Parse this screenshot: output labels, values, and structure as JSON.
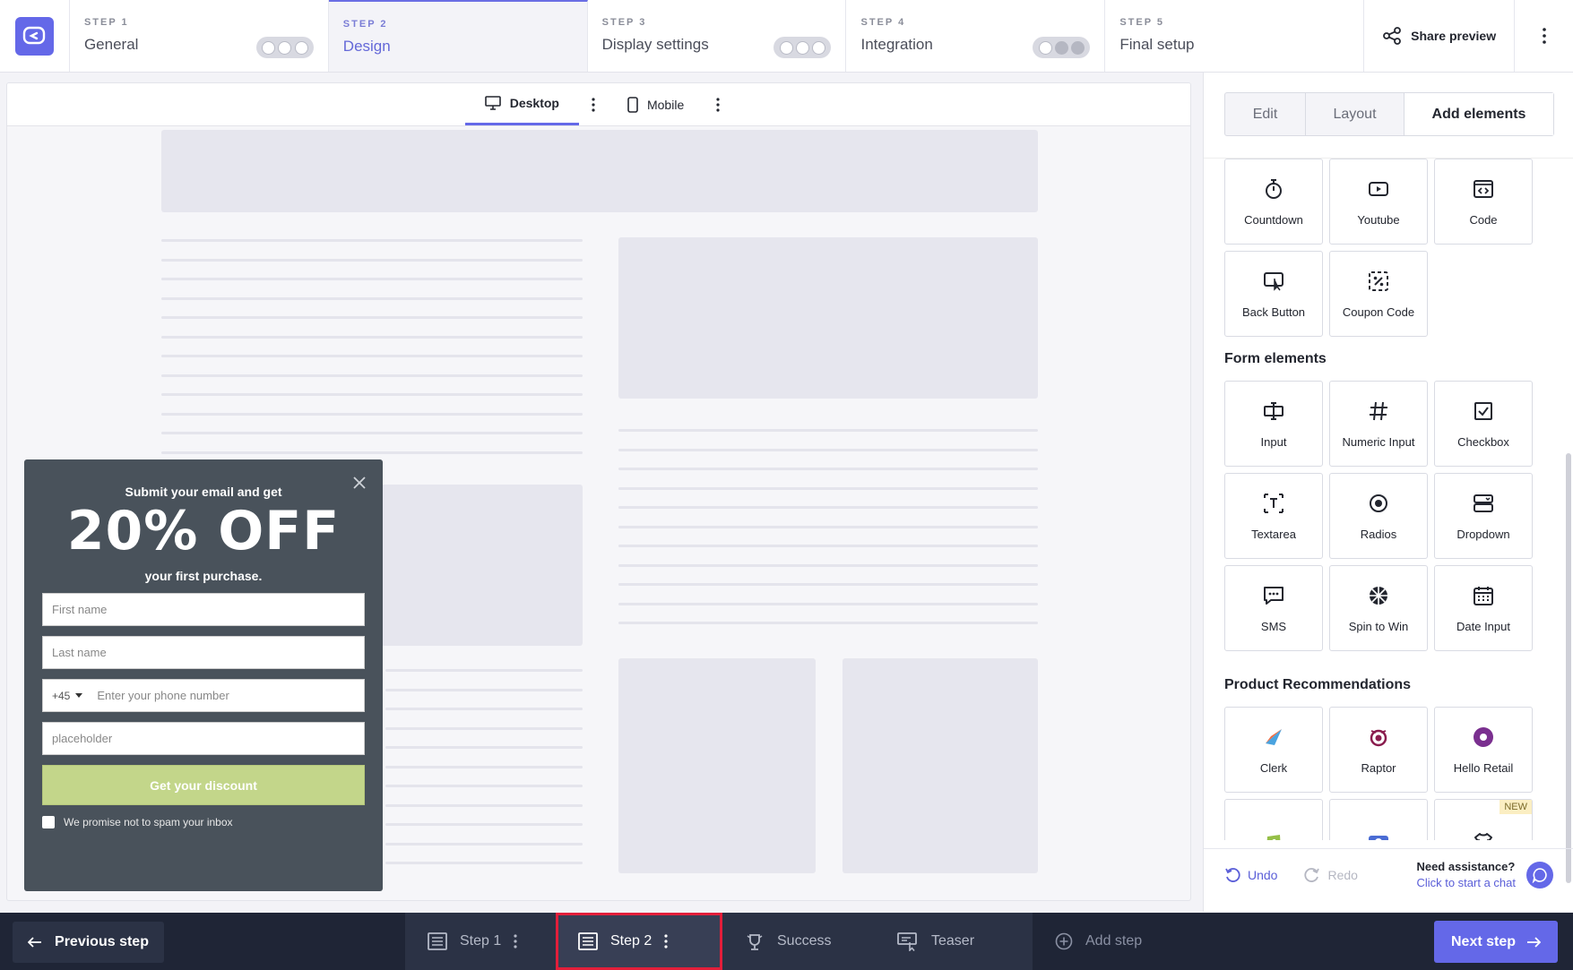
{
  "steps": [
    {
      "num": "STEP 1",
      "name": "General"
    },
    {
      "num": "STEP 2",
      "name": "Design"
    },
    {
      "num": "STEP 3",
      "name": "Display settings"
    },
    {
      "num": "STEP 4",
      "name": "Integration"
    },
    {
      "num": "STEP 5",
      "name": "Final setup"
    }
  ],
  "header": {
    "share_label": "Share preview"
  },
  "device_tabs": {
    "desktop": "Desktop",
    "mobile": "Mobile"
  },
  "popup": {
    "pre": "Submit your email and get",
    "headline": "20% OFF",
    "sub": "your first purchase.",
    "first_name_placeholder": "First name",
    "last_name_placeholder": "Last name",
    "phone_prefix": "+45",
    "phone_placeholder": "Enter your phone number",
    "extra_placeholder": "placeholder",
    "button": "Get your discount",
    "checkbox_label": "We promise not to spam your inbox"
  },
  "panel": {
    "tabs": [
      "Edit",
      "Layout",
      "Add elements"
    ],
    "basic_elements": [
      "Countdown",
      "Youtube",
      "Code",
      "Back Button",
      "Coupon Code"
    ],
    "form_title": "Form elements",
    "form_elements": [
      "Input",
      "Numeric Input",
      "Checkbox",
      "Textarea",
      "Radios",
      "Dropdown",
      "SMS",
      "Spin to Win",
      "Date Input"
    ],
    "product_title": "Product Recommendations",
    "product_elements": [
      "Clerk",
      "Raptor",
      "Hello Retail"
    ],
    "new_badge": "NEW",
    "undo": "Undo",
    "redo": "Redo",
    "assist_title": "Need assistance?",
    "assist_link": "Click to start a chat"
  },
  "bottom": {
    "prev": "Previous step",
    "tabs": [
      "Step 1",
      "Step 2",
      "Success",
      "Teaser",
      "Add step"
    ],
    "next": "Next step"
  },
  "colors": {
    "accent": "#6468e8",
    "popup_bg": "#49525b",
    "cta": "#c3d68a",
    "bottom_bg": "#1f2536",
    "highlight": "#e31e3a"
  }
}
